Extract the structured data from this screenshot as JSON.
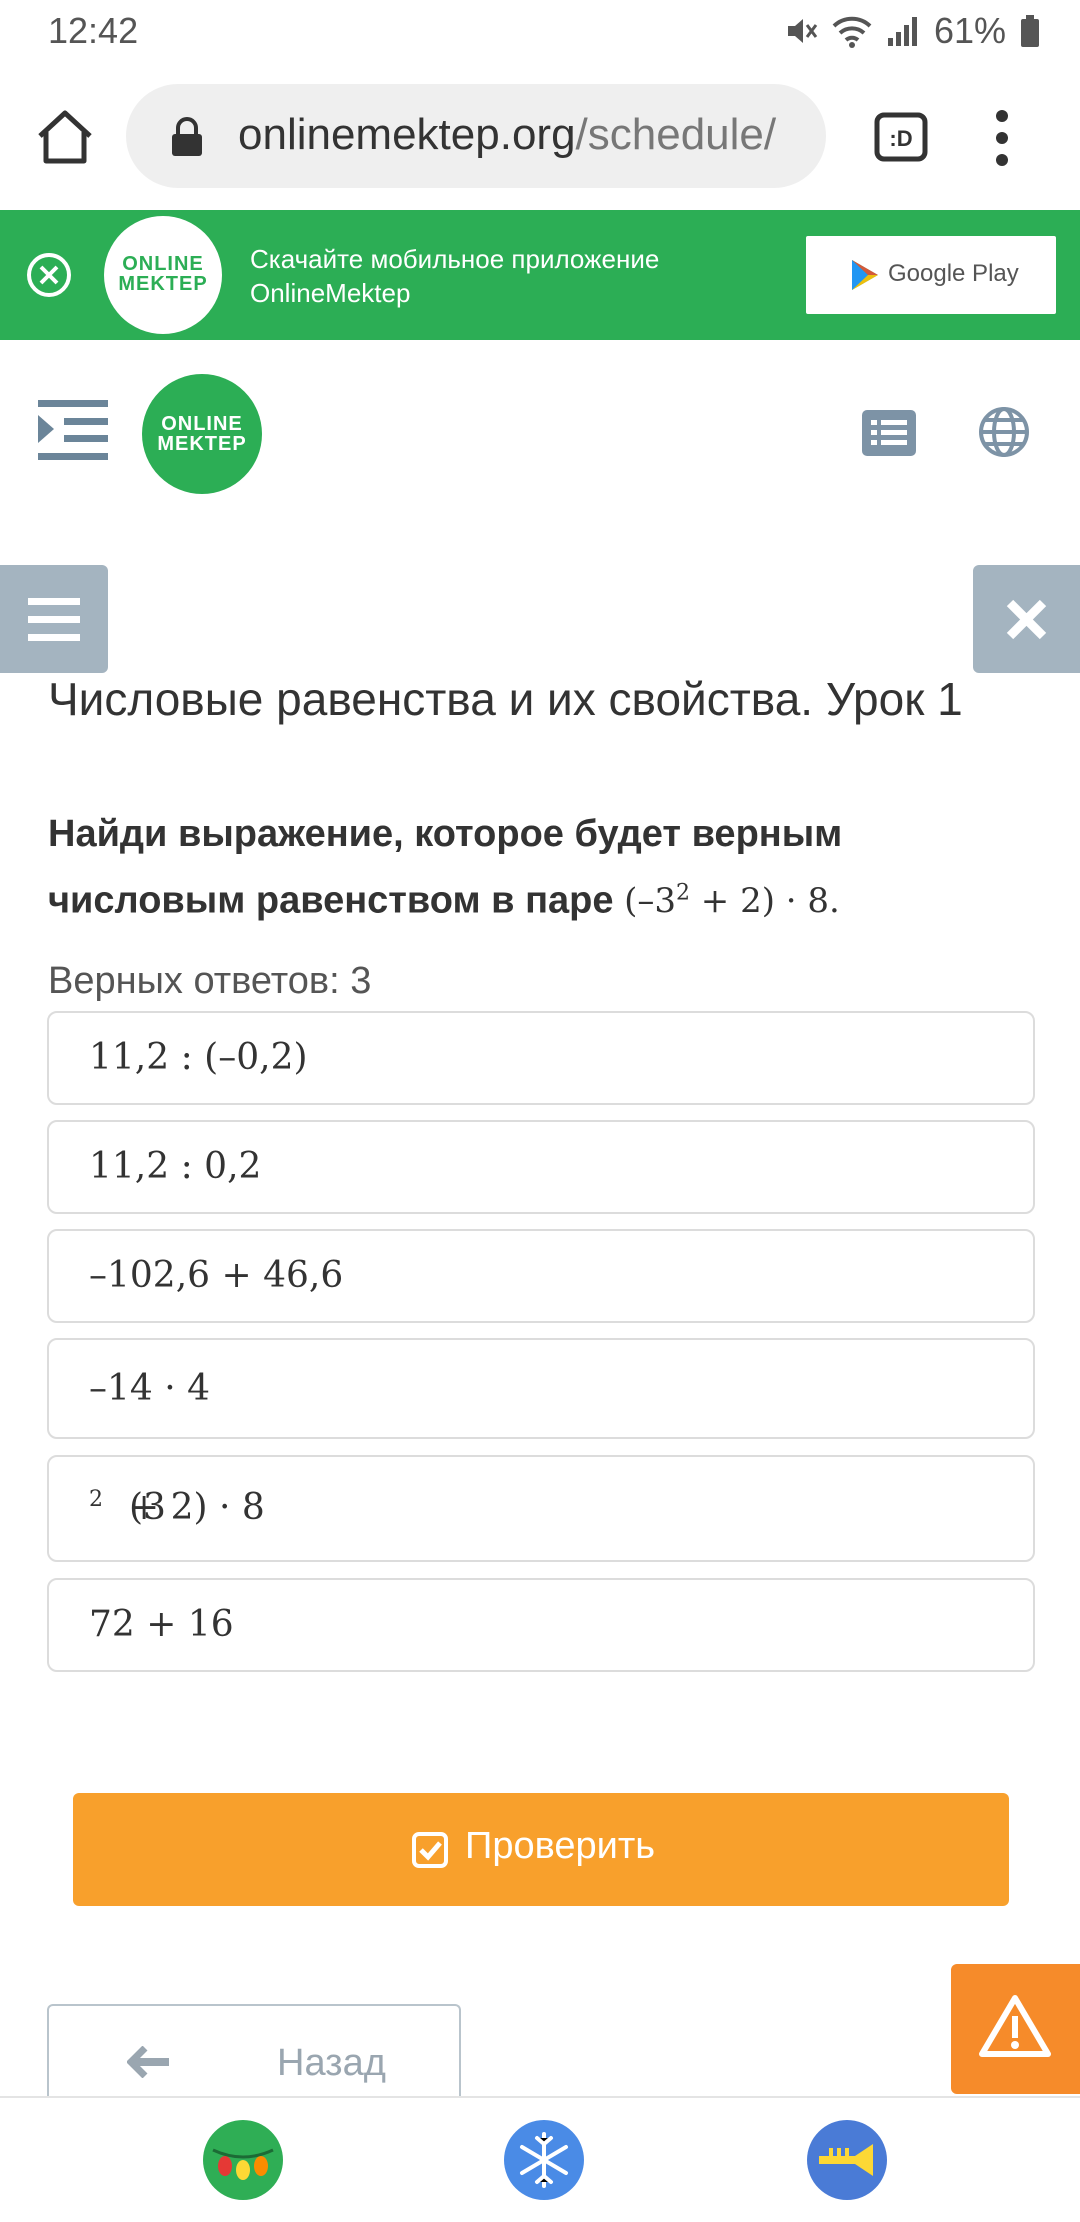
{
  "status_bar": {
    "time": "12:42",
    "battery": "61%"
  },
  "browser": {
    "url_domain": "onlinemektep.org",
    "url_path": "/schedule/",
    "tab_label": ":D"
  },
  "app_banner": {
    "logo_line1": "ONLINE",
    "logo_line2": "MEKTEP",
    "line1": "Скачайте мобильное приложение",
    "line2": "OnlineMektep",
    "store_label": "Google Play"
  },
  "header": {
    "logo_line1": "ONLINE",
    "logo_line2": "MEKTEP"
  },
  "lesson": {
    "title": "Числовые равенства и их свойства. Урок 1",
    "question_text": "Найди выражение, которое будет верным числовым равенством в паре",
    "question_formula_pre": "(–3",
    "question_formula_sup": "2",
    "question_formula_post": " + 2) · 8.",
    "answers_count": "Верных ответов: 3",
    "options": [
      "11,2 : (–0,2)",
      "11,2 : 0,2",
      "–102,6 + 46,6",
      "–14 · 4",
      "(3",
      "72 + 16"
    ],
    "option5_sup": "2",
    "option5_post": " + 2) · 8",
    "check_label": "Проверить",
    "back_label": "Назад"
  },
  "colors": {
    "brand_green": "#2cae55",
    "check_orange": "#f8a02c",
    "report_orange": "#f68b2a",
    "side_button_gray": "#a4b4c0"
  }
}
